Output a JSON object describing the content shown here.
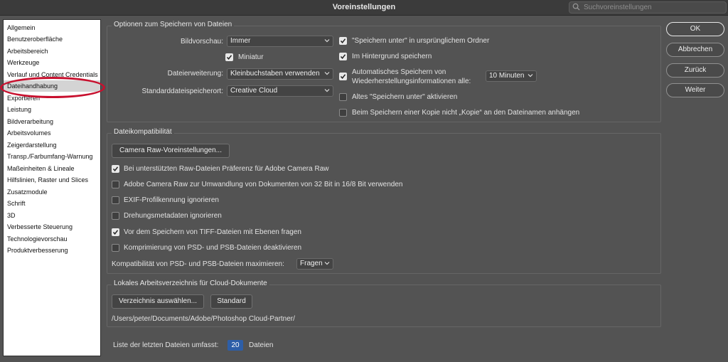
{
  "window": {
    "title": "Voreinstellungen"
  },
  "search": {
    "placeholder": "Suchvoreinstellungen"
  },
  "sidebar": {
    "items": [
      {
        "label": "Allgemein"
      },
      {
        "label": "Benutzeroberfläche"
      },
      {
        "label": "Arbeitsbereich"
      },
      {
        "label": "Werkzeuge"
      },
      {
        "label": "Verlauf und Content Credentials"
      },
      {
        "label": "Dateihandhabung"
      },
      {
        "label": "Exportieren"
      },
      {
        "label": "Leistung"
      },
      {
        "label": "Bildverarbeitung"
      },
      {
        "label": "Arbeitsvolumes"
      },
      {
        "label": "Zeigerdarstellung"
      },
      {
        "label": "Transp./Farbumfang-Warnung"
      },
      {
        "label": "Maßeinheiten & Lineale"
      },
      {
        "label": "Hilfslinien, Raster und Slices"
      },
      {
        "label": "Zusatzmodule"
      },
      {
        "label": "Schrift"
      },
      {
        "label": "3D"
      },
      {
        "label": "Verbesserte Steuerung"
      },
      {
        "label": "Technologievorschau"
      },
      {
        "label": "Produktverbesserung"
      }
    ],
    "selected": "Dateihandhabung"
  },
  "save_options": {
    "legend": "Optionen zum Speichern von Dateien",
    "preview_label": "Bildvorschau:",
    "preview_value": "Immer",
    "thumbnail_label": "Miniatur",
    "extension_label": "Dateierweiterung:",
    "extension_value": "Kleinbuchstaben verwenden",
    "location_label": "Standarddateispeicherort:",
    "location_value": "Creative Cloud",
    "save_as_original": "\"Speichern unter\" in ursprünglichem Ordner",
    "background_save": "Im Hintergrund speichern",
    "autosave_line1": "Automatisches Speichern von",
    "autosave_line2": "Wiederherstellungsinformationen alle:",
    "autosave_value": "10 Minuten",
    "legacy_save_as": "Altes \"Speichern unter\" aktivieren",
    "no_copy_suffix": "Beim Speichern einer Kopie nicht „Kopie“ an den Dateinamen anhängen"
  },
  "compat": {
    "legend": "Dateikompatibilität",
    "camera_raw_button": "Camera Raw-Voreinstellungen...",
    "prefer_acr": "Bei unterstützten Raw-Dateien Präferenz für Adobe Camera Raw",
    "acr_32bit": "Adobe Camera Raw zur Umwandlung von Dokumenten von 32 Bit in 16/8 Bit verwenden",
    "ignore_exif": "EXIF-Profilkennung ignorieren",
    "ignore_rotation": "Drehungsmetadaten ignorieren",
    "ask_tiff": "Vor dem Speichern von TIFF-Dateien mit Ebenen fragen",
    "disable_compression": "Komprimierung von PSD- und PSB-Dateien deaktivieren",
    "maximize_label": "Kompatibilität von PSD- und PSB-Dateien maximieren:",
    "maximize_value": "Fragen"
  },
  "cloud": {
    "legend": "Lokales Arbeitsverzeichnis für Cloud-Dokumente",
    "choose_button": "Verzeichnis auswählen...",
    "default_button": "Standard",
    "path": "/Users/peter/Documents/Adobe/Photoshop Cloud-Partner/"
  },
  "recent": {
    "label": "Liste der letzten Dateien umfasst:",
    "value": "20",
    "unit": "Dateien"
  },
  "buttons": {
    "ok": "OK",
    "cancel": "Abbrechen",
    "back": "Zurück",
    "next": "Weiter"
  },
  "states": {
    "thumbnail": true,
    "save_as_original": true,
    "background_save": true,
    "autosave": true,
    "legacy_save_as": false,
    "no_copy_suffix": false,
    "prefer_acr": true,
    "acr_32bit": false,
    "ignore_exif": false,
    "ignore_rotation": false,
    "ask_tiff": true,
    "disable_compression": false
  },
  "colors": {
    "annotation": "#c8102e",
    "selection": "#d4d4d4",
    "number_field": "#2d5ea8"
  }
}
